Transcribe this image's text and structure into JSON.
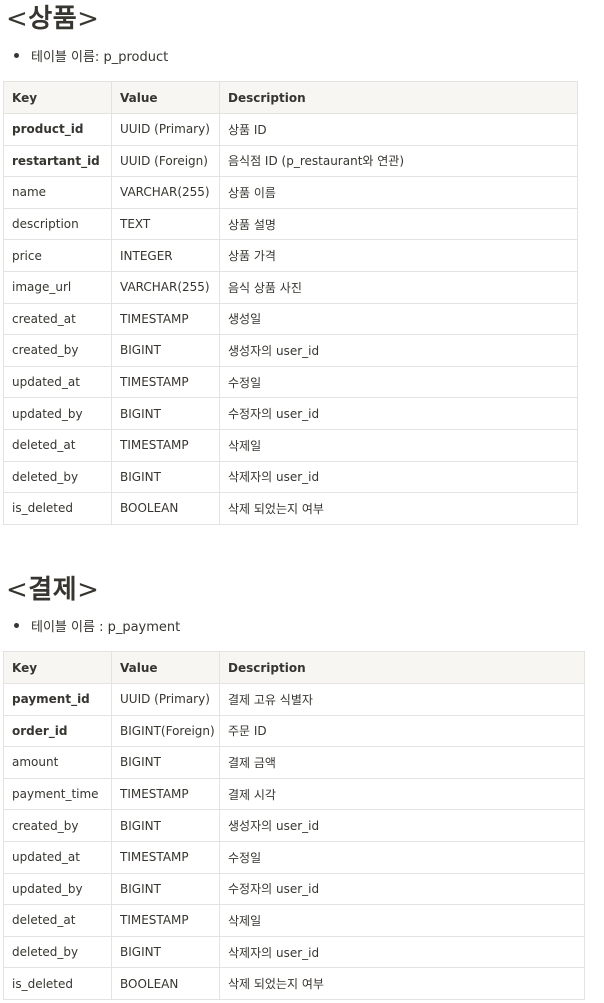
{
  "product": {
    "heading_open": "<",
    "heading_title": "상품",
    "heading_close": ">",
    "table_name_text": "테이블 이름: p_product",
    "columns": [
      "Key",
      "Value",
      "Description"
    ],
    "rows": [
      {
        "key": "product_id",
        "value": "UUID (Primary)",
        "description": "상품 ID",
        "bold": true
      },
      {
        "key": "restartant_id",
        "value": "UUID (Foreign)",
        "description": "음식점 ID (p_restaurant와 연관)",
        "bold": true
      },
      {
        "key": "name",
        "value": "VARCHAR(255)",
        "description": "상품 이름",
        "bold": false
      },
      {
        "key": "description",
        "value": "TEXT",
        "description": "상품 설명",
        "bold": false
      },
      {
        "key": "price",
        "value": "INTEGER",
        "description": "상품 가격",
        "bold": false
      },
      {
        "key": "image_url",
        "value": "VARCHAR(255)",
        "description": "음식 상품 사진",
        "bold": false
      },
      {
        "key": "created_at",
        "value": "TIMESTAMP",
        "description": "생성일",
        "bold": false
      },
      {
        "key": "created_by",
        "value": "BIGINT",
        "description": "생성자의 user_id",
        "bold": false
      },
      {
        "key": "updated_at",
        "value": "TIMESTAMP",
        "description": "수정일",
        "bold": false
      },
      {
        "key": "updated_by",
        "value": "BIGINT",
        "description": "수정자의 user_id",
        "bold": false
      },
      {
        "key": "deleted_at",
        "value": "TIMESTAMP",
        "description": "삭제일",
        "bold": false
      },
      {
        "key": "deleted_by",
        "value": "BIGINT",
        "description": "삭제자의 user_id",
        "bold": false
      },
      {
        "key": "is_deleted",
        "value": "BOOLEAN",
        "description": "삭제 되었는지 여부",
        "bold": false
      }
    ]
  },
  "payment": {
    "heading_open": "<",
    "heading_title": "결제",
    "heading_close": ">",
    "table_name_text": "테이블 이름 : p_payment",
    "columns": [
      "Key",
      "Value",
      "Description"
    ],
    "rows": [
      {
        "key": "payment_id",
        "value": "UUID (Primary)",
        "description": "결제 고유 식별자",
        "bold": true
      },
      {
        "key": "order_id",
        "value": "BIGINT(Foreign)",
        "description": "주문 ID",
        "bold": true
      },
      {
        "key": "amount",
        "value": "BIGINT",
        "description": "결제 금액",
        "bold": false
      },
      {
        "key": "payment_time",
        "value": "TIMESTAMP",
        "description": "결제 시각",
        "bold": false
      },
      {
        "key": "created_by",
        "value": "BIGINT",
        "description": "생성자의 user_id",
        "bold": false
      },
      {
        "key": "updated_at",
        "value": "TIMESTAMP",
        "description": "수정일",
        "bold": false
      },
      {
        "key": "updated_by",
        "value": "BIGINT",
        "description": "수정자의 user_id",
        "bold": false
      },
      {
        "key": "deleted_at",
        "value": "TIMESTAMP",
        "description": "삭제일",
        "bold": false
      },
      {
        "key": "deleted_by",
        "value": "BIGINT",
        "description": "삭제자의 user_id",
        "bold": false
      },
      {
        "key": "is_deleted",
        "value": "BOOLEAN",
        "description": "삭제 되었는지 여부",
        "bold": false
      }
    ]
  }
}
